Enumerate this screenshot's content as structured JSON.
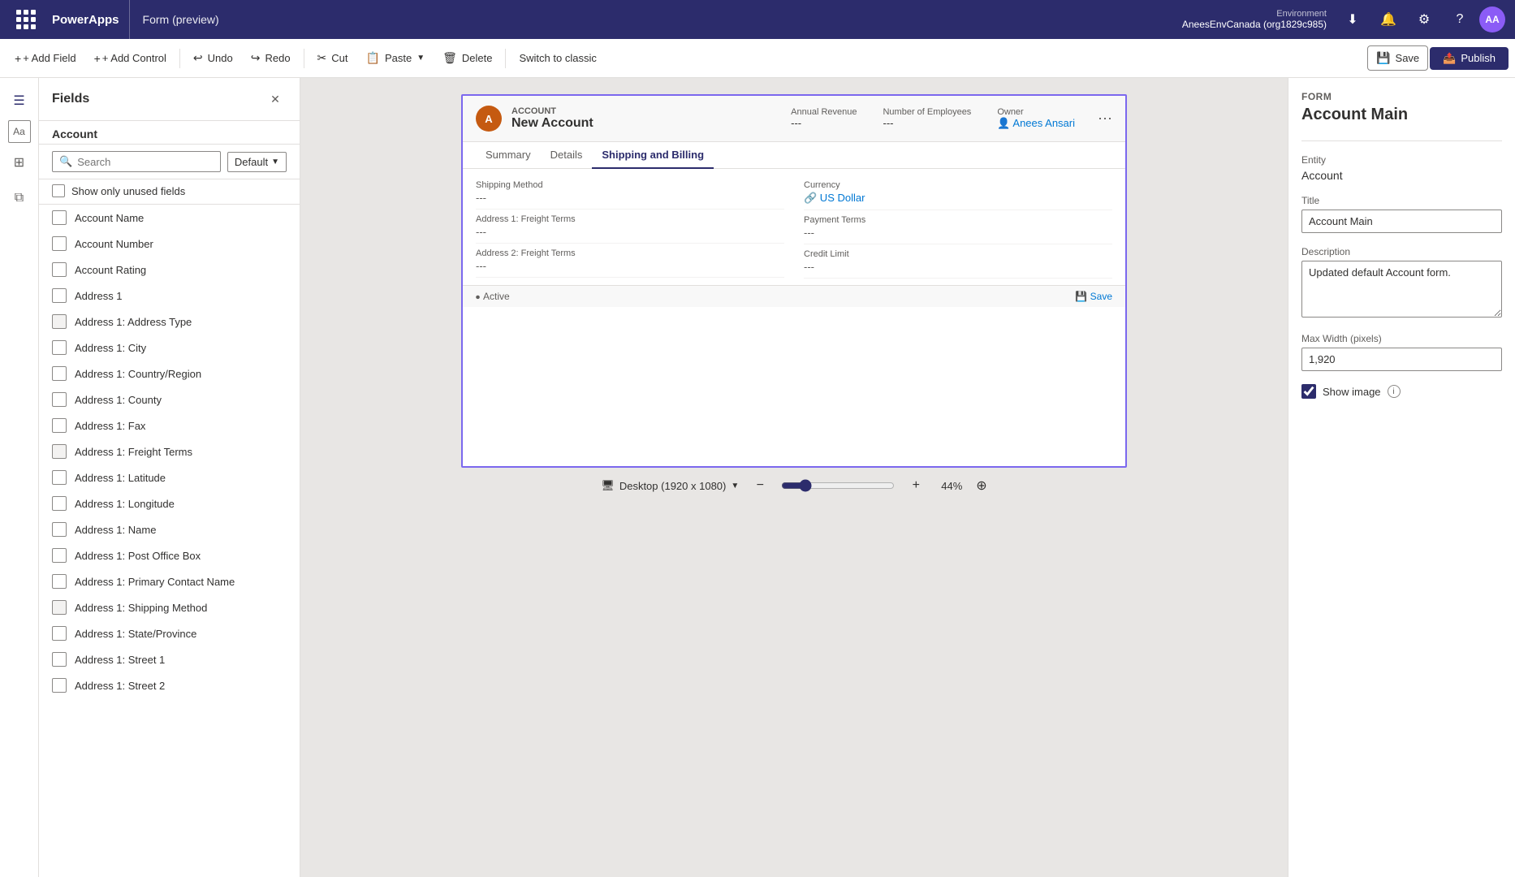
{
  "topbar": {
    "app_name": "PowerApps",
    "page_title": "Form (preview)",
    "environment_label": "Environment",
    "environment_name": "AneesEnvCanada (org1829c985)",
    "avatar_initials": "AA"
  },
  "toolbar": {
    "add_field": "+ Add Field",
    "add_control": "+ Add Control",
    "undo": "Undo",
    "redo": "Redo",
    "cut": "Cut",
    "paste": "Paste",
    "delete": "Delete",
    "switch_classic": "Switch to classic",
    "save": "Save",
    "publish": "Publish"
  },
  "fields_panel": {
    "title": "Fields",
    "entity": "Account",
    "search_placeholder": "Search",
    "dropdown_label": "Default",
    "show_unused": "Show only unused fields",
    "items": [
      {
        "label": "Account Name",
        "type": "grid"
      },
      {
        "label": "Account Number",
        "type": "grid"
      },
      {
        "label": "Account Rating",
        "type": "grid"
      },
      {
        "label": "Address 1",
        "type": "grid"
      },
      {
        "label": "Address 1: Address Type",
        "type": "rect"
      },
      {
        "label": "Address 1: City",
        "type": "grid"
      },
      {
        "label": "Address 1: Country/Region",
        "type": "grid"
      },
      {
        "label": "Address 1: County",
        "type": "grid"
      },
      {
        "label": "Address 1: Fax",
        "type": "grid"
      },
      {
        "label": "Address 1: Freight Terms",
        "type": "rect"
      },
      {
        "label": "Address 1: Latitude",
        "type": "grid"
      },
      {
        "label": "Address 1: Longitude",
        "type": "grid"
      },
      {
        "label": "Address 1: Name",
        "type": "grid"
      },
      {
        "label": "Address 1: Post Office Box",
        "type": "grid"
      },
      {
        "label": "Address 1: Primary Contact Name",
        "type": "grid"
      },
      {
        "label": "Address 1: Shipping Method",
        "type": "rect"
      },
      {
        "label": "Address 1: State/Province",
        "type": "grid"
      },
      {
        "label": "Address 1: Street 1",
        "type": "grid"
      },
      {
        "label": "Address 1: Street 2",
        "type": "grid"
      }
    ]
  },
  "form_preview": {
    "entity_label": "ACCOUNT",
    "record_name": "New Account",
    "header_fields": [
      {
        "label": "Annual Revenue",
        "value": "---"
      },
      {
        "label": "Number of Employees",
        "value": "---"
      },
      {
        "label": "Owner",
        "value": "Anees Ansari",
        "linked": true
      }
    ],
    "tabs": [
      "Summary",
      "Details",
      "Shipping and Billing"
    ],
    "active_tab": "Shipping and Billing",
    "left_fields": [
      {
        "label": "Shipping Method",
        "value": "---"
      },
      {
        "label": "Address 1: Freight Terms",
        "value": "---"
      },
      {
        "label": "Address 2: Freight Terms",
        "value": "---"
      }
    ],
    "right_fields": [
      {
        "label": "Currency",
        "value": "US Dollar",
        "linked": true
      },
      {
        "label": "Payment Terms",
        "value": "---"
      },
      {
        "label": "Credit Limit",
        "value": "---"
      }
    ],
    "footer_status": "Active",
    "footer_save": "Save"
  },
  "canvas": {
    "zoom_value": 44,
    "zoom_display": "44%",
    "desktop_label": "Desktop (1920 x 1080)"
  },
  "right_panel": {
    "section_label": "Form",
    "title": "Account Main",
    "entity_label": "Entity",
    "entity_value": "Account",
    "title_label": "Title",
    "title_value": "Account Main",
    "description_label": "Description",
    "description_value": "Updated default Account form.",
    "max_width_label": "Max Width (pixels)",
    "max_width_value": "1,920",
    "show_image_label": "Show image",
    "show_image_checked": true
  }
}
